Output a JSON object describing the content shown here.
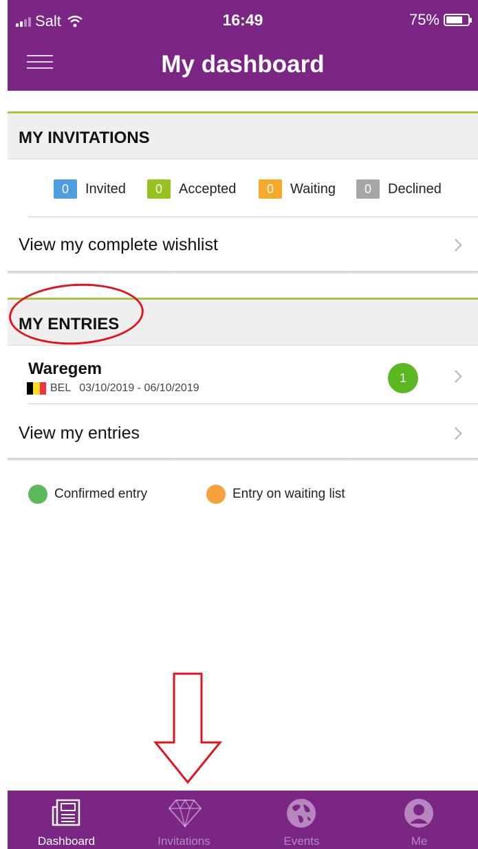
{
  "status_bar": {
    "carrier": "Salt",
    "time": "16:49",
    "battery": "75%",
    "battery_level": 0.75
  },
  "header": {
    "title": "My dashboard"
  },
  "invitations": {
    "title": "MY INVITATIONS",
    "counts": [
      {
        "value": "0",
        "label": "Invited",
        "color": "#4d9de0"
      },
      {
        "value": "0",
        "label": "Accepted",
        "color": "#97c11f"
      },
      {
        "value": "0",
        "label": "Waiting",
        "color": "#f6a92b"
      },
      {
        "value": "0",
        "label": "Declined",
        "color": "#a6a6a6"
      }
    ],
    "wishlist_link": "View my complete wishlist"
  },
  "entries": {
    "title": "MY ENTRIES",
    "items": [
      {
        "name": "Waregem",
        "country": "BEL",
        "dates": "03/10/2019 - 06/10/2019",
        "count": "1"
      }
    ],
    "view_link": "View my entries"
  },
  "legend": [
    {
      "label": "Confirmed entry",
      "color": "#5bb85b"
    },
    {
      "label": "Entry on waiting list",
      "color": "#f7a23b"
    }
  ],
  "tabs": [
    {
      "label": "Dashboard",
      "icon": "newspaper-icon",
      "active": true
    },
    {
      "label": "Invitations",
      "icon": "diamond-icon",
      "active": false
    },
    {
      "label": "Events",
      "icon": "globe-icon",
      "active": false
    },
    {
      "label": "Me",
      "icon": "user-icon",
      "active": false
    }
  ],
  "colors": {
    "brand": "#7b2585",
    "section_accent": "#a7c63f",
    "annotation": "#e0141e"
  }
}
